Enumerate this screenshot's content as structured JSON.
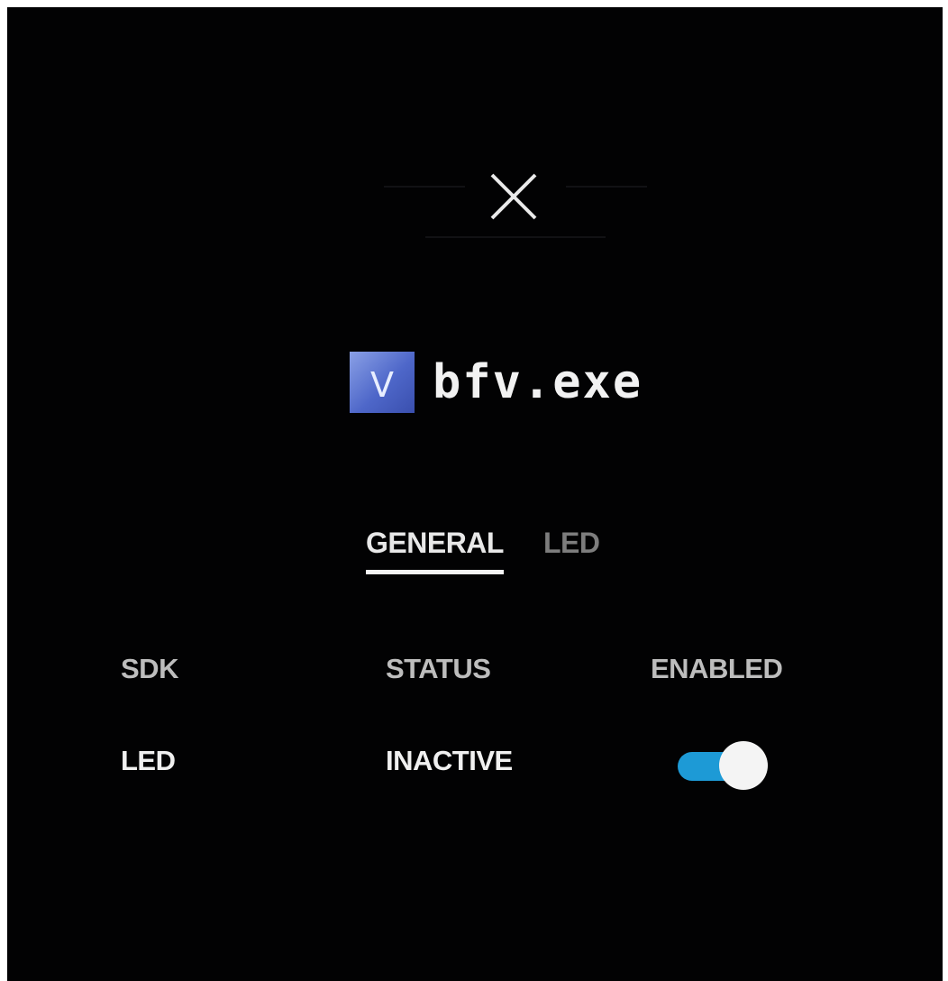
{
  "header": {
    "hint_text": "",
    "close_icon": "close-icon"
  },
  "app": {
    "logo_icon": "app-logo-icon",
    "logo_letter": "V",
    "name": "bfv.exe"
  },
  "tabs": [
    {
      "label": "GENERAL",
      "active": true
    },
    {
      "label": "LED",
      "active": false
    }
  ],
  "table": {
    "headers": [
      "SDK",
      "STATUS",
      "ENABLED"
    ],
    "rows": [
      {
        "sdk": "LED",
        "status": "INACTIVE",
        "enabled": true
      }
    ]
  },
  "colors": {
    "background": "#020203",
    "accent": "#1d9ad6",
    "text": "#f0f0f0",
    "muted_text": "#7d7d7d"
  }
}
